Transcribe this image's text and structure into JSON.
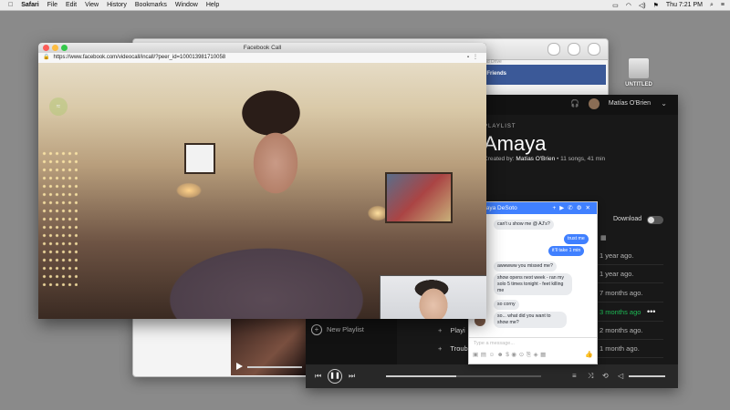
{
  "menubar": {
    "apple": "",
    "items": [
      "Safari",
      "File",
      "Edit",
      "View",
      "History",
      "Bookmarks",
      "Window",
      "Help"
    ],
    "clock": "Thu 7:21 PM"
  },
  "desktop": {
    "drive_label": "UNTITLED"
  },
  "fb_window": {
    "sub": "ind Drive",
    "friends_label": "d Friends"
  },
  "call_window": {
    "title": "Facebook Call",
    "url": "https://www.facebook.com/videocall/incall/?peer_id=100013981710058"
  },
  "spotify": {
    "user": "Matías O'Brien",
    "playlist_type": "PLAYLIST",
    "playlist_title": "Amaya",
    "created_by_label": "Created by:",
    "created_by_name": "Matías O'Brien",
    "meta": "• 11 songs, 41 min",
    "download_label": "Download",
    "dates": [
      {
        "text": "1 year ago.",
        "active": false
      },
      {
        "text": "1 year ago.",
        "active": false
      },
      {
        "text": "7 months ago.",
        "active": false
      },
      {
        "text": "3 months ago",
        "active": true
      },
      {
        "text": "2 months ago.",
        "active": false
      },
      {
        "text": "1 month ago.",
        "active": false
      }
    ],
    "new_playlist": "New Playlist",
    "tracks": [
      "Playi",
      "Troub"
    ],
    "progress": 0.45
  },
  "chat": {
    "name": "Amaya DeSoto",
    "messages": [
      {
        "dir": "in",
        "text": "can't u show me @ AJ's?"
      },
      {
        "dir": "out",
        "text": "trust me"
      },
      {
        "dir": "out",
        "text": "it'll take 1 min"
      },
      {
        "dir": "in",
        "text": "awwwww you missed me?"
      },
      {
        "dir": "in",
        "text": "show opens next week - ran my solo 5 times tonight - feet killing me"
      },
      {
        "dir": "in",
        "text": "so corny"
      },
      {
        "dir": "in",
        "text": "so... what did you want to show me?"
      }
    ],
    "placeholder": "Type a message..."
  },
  "colors": {
    "spotify_green": "#1db954",
    "messenger_blue": "#4080ff",
    "facebook_blue": "#3b5998"
  }
}
